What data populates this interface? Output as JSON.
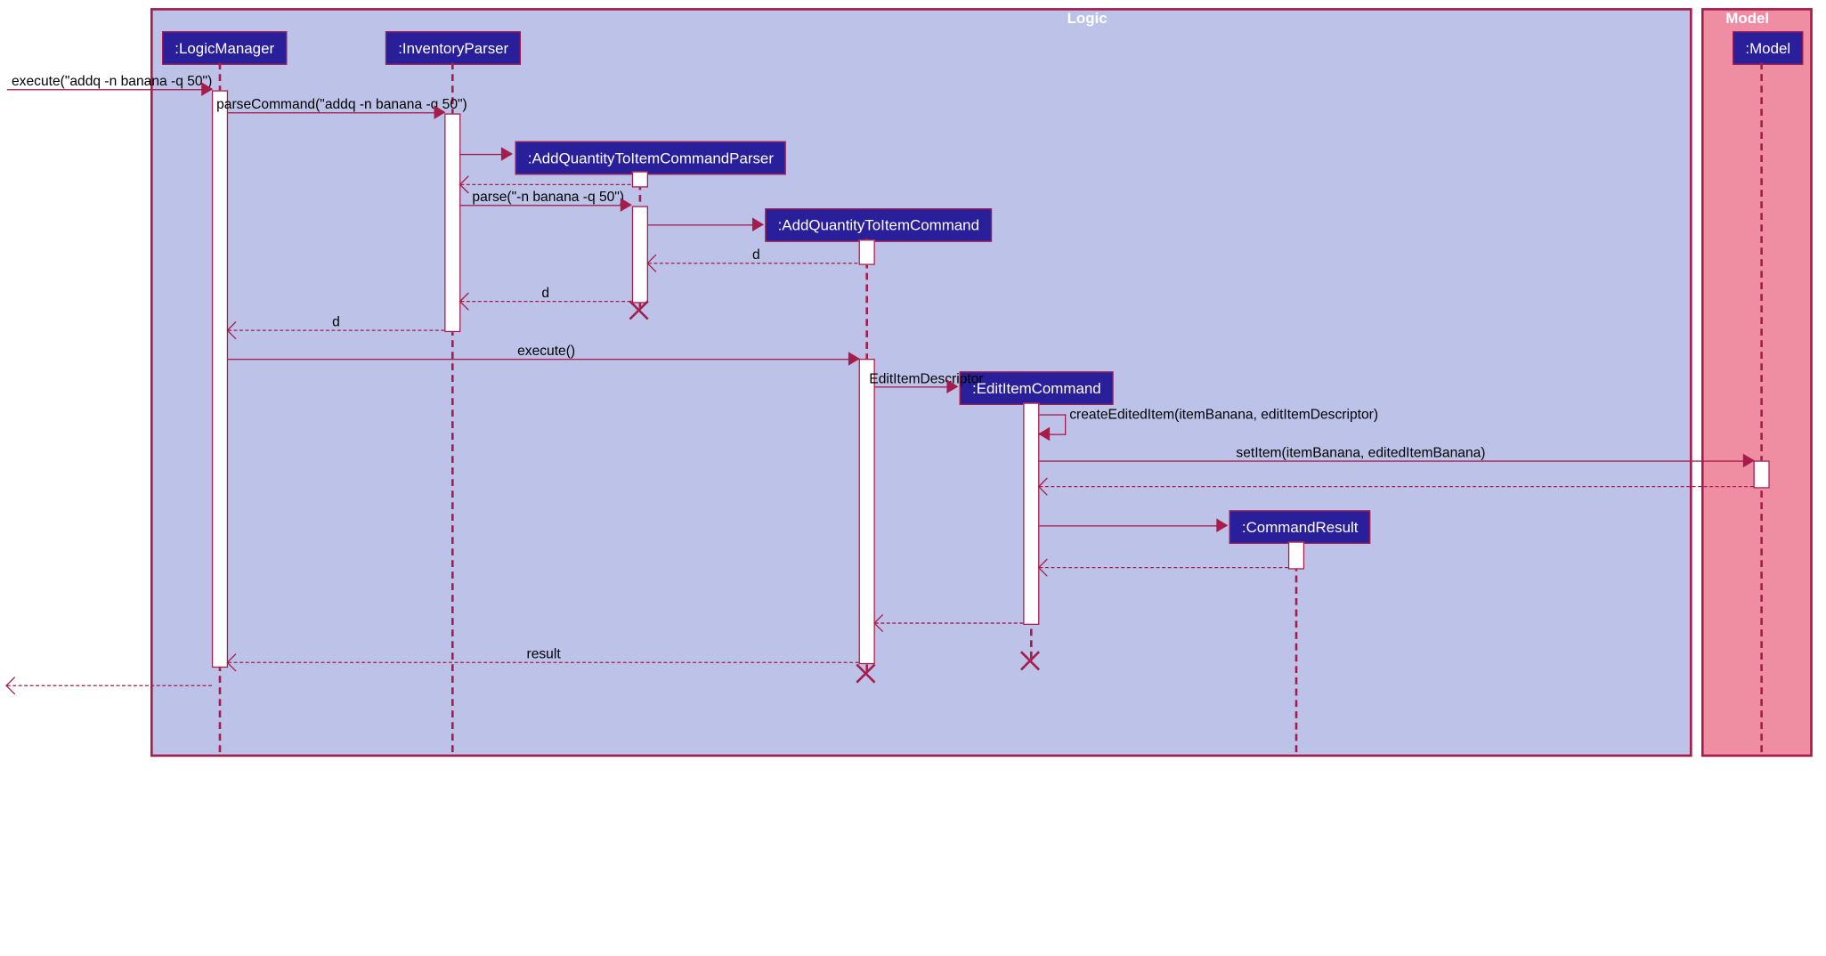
{
  "frames": {
    "logic": "Logic",
    "model": "Model"
  },
  "participants": {
    "logicManager": ":LogicManager",
    "inventoryParser": ":InventoryParser",
    "parser": ":AddQuantityToItemCommandParser",
    "cmd": ":AddQuantityToItemCommand",
    "edit": ":EditItemCommand",
    "result": ":CommandResult",
    "mdl": ":Model"
  },
  "messages": {
    "m1": "execute(\"addq -n banana -q 50\")",
    "m2": "parseCommand(\"addq -n banana -q 50\")",
    "m3": "parse(\"-n banana -q 50\")",
    "d": "d",
    "exec": "execute()",
    "desc": "EditItemDescriptor",
    "create": "createEditedItem(itemBanana, editItemDescriptor)",
    "set": "setItem(itemBanana, editedItemBanana)",
    "res": "result"
  },
  "chart_data": {
    "type": "uml-sequence-diagram",
    "frames": [
      {
        "name": "Logic",
        "participants": [
          "LogicManager",
          "InventoryParser",
          "AddQuantityToItemCommandParser",
          "AddQuantityToItemCommand",
          "EditItemCommand",
          "CommandResult"
        ]
      },
      {
        "name": "Model",
        "participants": [
          "Model"
        ]
      }
    ],
    "participants": [
      "LogicManager",
      "InventoryParser",
      "AddQuantityToItemCommandParser",
      "AddQuantityToItemCommand",
      "EditItemCommand",
      "CommandResult",
      "Model"
    ],
    "messages": [
      {
        "from": "",
        "to": "LogicManager",
        "label": "execute(\"addq -n banana -q 50\")",
        "type": "sync"
      },
      {
        "from": "LogicManager",
        "to": "InventoryParser",
        "label": "parseCommand(\"addq -n banana -q 50\")",
        "type": "sync"
      },
      {
        "from": "InventoryParser",
        "to": "AddQuantityToItemCommandParser",
        "label": "",
        "type": "create"
      },
      {
        "from": "AddQuantityToItemCommandParser",
        "to": "InventoryParser",
        "label": "",
        "type": "return"
      },
      {
        "from": "InventoryParser",
        "to": "AddQuantityToItemCommandParser",
        "label": "parse(\"-n banana -q 50\")",
        "type": "sync"
      },
      {
        "from": "AddQuantityToItemCommandParser",
        "to": "AddQuantityToItemCommand",
        "label": "",
        "type": "create"
      },
      {
        "from": "AddQuantityToItemCommand",
        "to": "AddQuantityToItemCommandParser",
        "label": "d",
        "type": "return"
      },
      {
        "from": "AddQuantityToItemCommandParser",
        "to": "InventoryParser",
        "label": "d",
        "type": "return"
      },
      {
        "from": "AddQuantityToItemCommandParser",
        "to": "",
        "label": "",
        "type": "destroy"
      },
      {
        "from": "InventoryParser",
        "to": "LogicManager",
        "label": "d",
        "type": "return"
      },
      {
        "from": "LogicManager",
        "to": "AddQuantityToItemCommand",
        "label": "execute()",
        "type": "sync"
      },
      {
        "from": "AddQuantityToItemCommand",
        "to": "EditItemCommand",
        "label": "EditItemDescriptor",
        "type": "create"
      },
      {
        "from": "EditItemCommand",
        "to": "EditItemCommand",
        "label": "createEditedItem(itemBanana, editItemDescriptor)",
        "type": "self"
      },
      {
        "from": "EditItemCommand",
        "to": "Model",
        "label": "setItem(itemBanana, editedItemBanana)",
        "type": "sync"
      },
      {
        "from": "Model",
        "to": "EditItemCommand",
        "label": "",
        "type": "return"
      },
      {
        "from": "EditItemCommand",
        "to": "CommandResult",
        "label": "",
        "type": "create"
      },
      {
        "from": "CommandResult",
        "to": "EditItemCommand",
        "label": "",
        "type": "return"
      },
      {
        "from": "EditItemCommand",
        "to": "AddQuantityToItemCommand",
        "label": "",
        "type": "return"
      },
      {
        "from": "EditItemCommand",
        "to": "",
        "label": "",
        "type": "destroy"
      },
      {
        "from": "AddQuantityToItemCommand",
        "to": "LogicManager",
        "label": "result",
        "type": "return"
      },
      {
        "from": "AddQuantityToItemCommand",
        "to": "",
        "label": "",
        "type": "destroy"
      },
      {
        "from": "LogicManager",
        "to": "",
        "label": "",
        "type": "return"
      }
    ]
  }
}
